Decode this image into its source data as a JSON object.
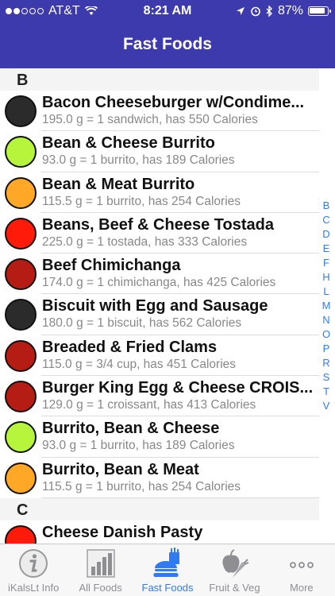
{
  "status": {
    "carrier": "AT&T",
    "time": "8:21 AM",
    "battery": "87%"
  },
  "header": {
    "title": "Fast Foods"
  },
  "sections": [
    {
      "letter": "B",
      "rows": [
        {
          "name": "Bacon Cheeseburger w/Condime...",
          "detail": "195.0 g = 1 sandwich, has 550 Calories",
          "color": "#2b2b2b"
        },
        {
          "name": "Bean & Cheese Burrito",
          "detail": "93.0 g = 1 burrito, has 189 Calories",
          "color": "#b6f53c"
        },
        {
          "name": "Bean & Meat Burrito",
          "detail": "115.5 g = 1 burrito, has 254 Calories",
          "color": "#ffa726"
        },
        {
          "name": "Beans, Beef & Cheese Tostada",
          "detail": "225.0 g = 1 tostada, has 333 Calories",
          "color": "#ff1a0a"
        },
        {
          "name": "Beef Chimichanga",
          "detail": "174.0 g = 1 chimichanga, has 425 Calories",
          "color": "#b51c14"
        },
        {
          "name": "Biscuit with Egg and Sausage",
          "detail": "180.0 g = 1 biscuit, has 562 Calories",
          "color": "#2b2b2b"
        },
        {
          "name": "Breaded & Fried Clams",
          "detail": "115.0 g = 3/4 cup, has 451 Calories",
          "color": "#b51c14"
        },
        {
          "name": "Burger King Egg & Cheese CROIS...",
          "detail": "129.0 g = 1 croissant, has 413 Calories",
          "color": "#b51c14"
        },
        {
          "name": "Burrito, Bean & Cheese",
          "detail": "93.0 g = 1 burrito, has 189 Calories",
          "color": "#b6f53c"
        },
        {
          "name": "Burrito, Bean & Meat",
          "detail": "115.5 g = 1 burrito, has 254 Calories",
          "color": "#ffa726"
        }
      ]
    },
    {
      "letter": "C",
      "rows": [
        {
          "name": "Cheese Danish Pasty",
          "detail": "",
          "color": "#ff1a0a"
        }
      ]
    }
  ],
  "index_letters": [
    "B",
    "C",
    "D",
    "E",
    "F",
    "H",
    "L",
    "M",
    "N",
    "O",
    "P",
    "R",
    "S",
    "T",
    "V"
  ],
  "tabs": [
    {
      "label": "iKalsLt Info",
      "icon": "info-icon"
    },
    {
      "label": "All Foods",
      "icon": "bar-chart-icon"
    },
    {
      "label": "Fast Foods",
      "icon": "burger-fries-icon",
      "active": true
    },
    {
      "label": "Fruit & Veg",
      "icon": "apple-carrot-icon"
    },
    {
      "label": "More",
      "icon": "more-dots-icon"
    }
  ],
  "colors": {
    "header_bg": "#3d3aae",
    "accent": "#2f7bf6"
  }
}
